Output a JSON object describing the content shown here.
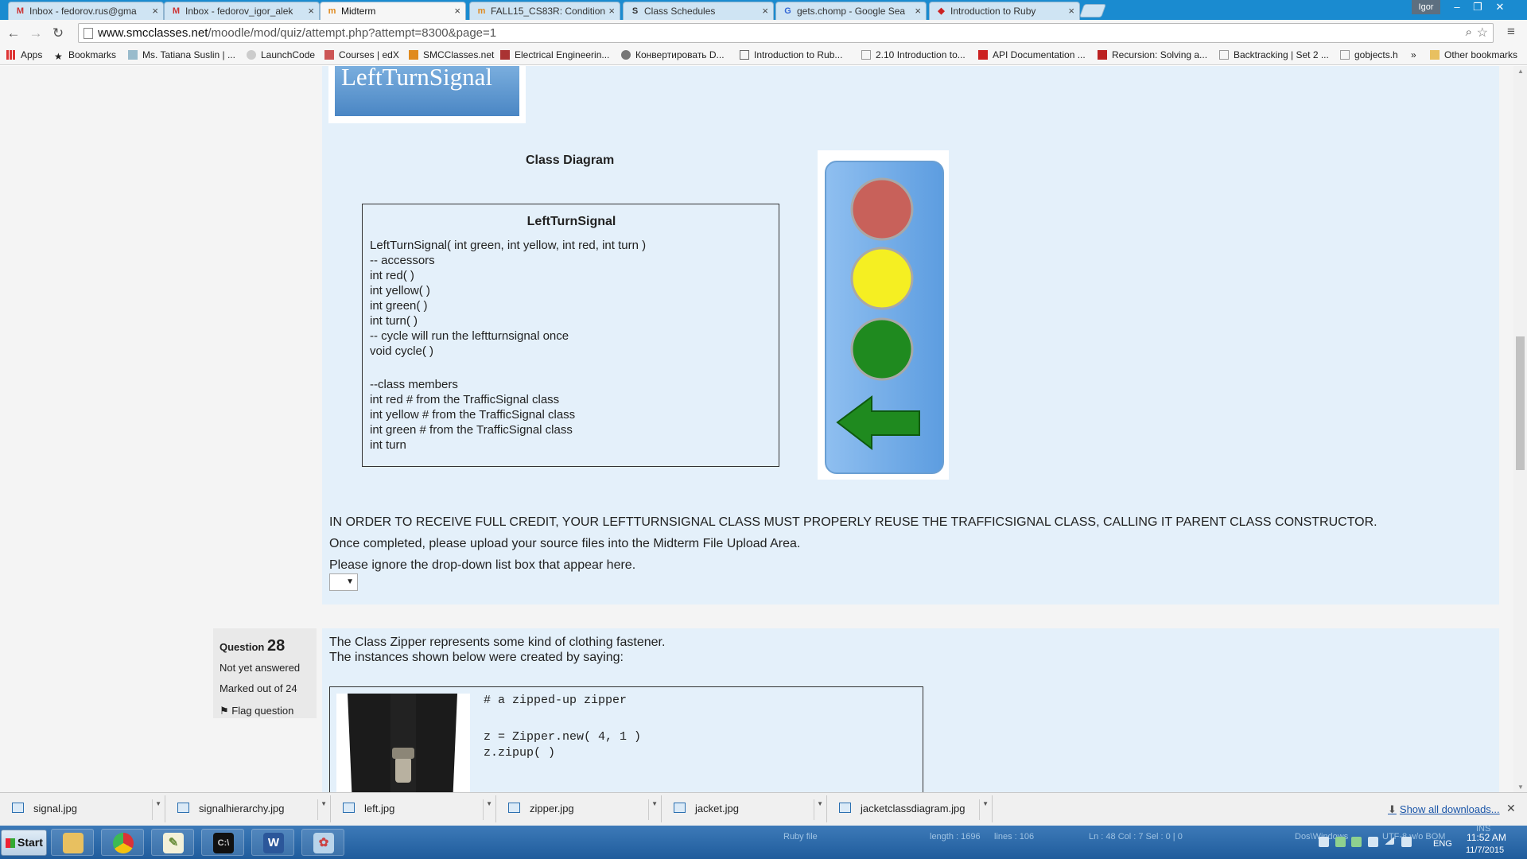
{
  "tabs": [
    {
      "title": "Inbox - fedorov.rus@gma",
      "icon": "gmail-icon"
    },
    {
      "title": "Inbox - fedorov_igor_alek",
      "icon": "gmail-icon"
    },
    {
      "title": "Midterm",
      "icon": "moodle-icon",
      "active": true
    },
    {
      "title": "FALL15_CS83R: Condition",
      "icon": "moodle-icon"
    },
    {
      "title": "Class Schedules",
      "icon": "smc-icon"
    },
    {
      "title": "gets.chomp - Google Sea",
      "icon": "google-icon"
    },
    {
      "title": "Introduction to Ruby",
      "icon": "ruby-icon"
    }
  ],
  "window": {
    "profile_name": "Igor",
    "minimize": "–",
    "restore": "❐",
    "close": "✕"
  },
  "address_bar": {
    "host": "www.smcclasses.net",
    "path": "/moodle/mod/quiz/attempt.php?attempt=8300&page=1"
  },
  "bookmarks": [
    {
      "label": "Apps",
      "icon": "apps-grid-icon"
    },
    {
      "label": "Bookmarks",
      "icon": "star-icon"
    },
    {
      "label": "Ms. Tatiana Suslin | ...",
      "icon": "site-icon"
    },
    {
      "label": "LaunchCode",
      "icon": "rocket-icon"
    },
    {
      "label": "Courses | edX",
      "icon": "edx-icon"
    },
    {
      "label": "SMCClasses.net",
      "icon": "moodle-icon"
    },
    {
      "label": "Electrical Engineerin...",
      "icon": "site-icon"
    },
    {
      "label": "Конвертировать D...",
      "icon": "site-icon"
    },
    {
      "label": "Introduction to Rub...",
      "icon": "page-icon"
    },
    {
      "label": "2.10 Introduction to...",
      "icon": "page-icon"
    },
    {
      "label": "API Documentation ...",
      "icon": "site-icon"
    },
    {
      "label": "Recursion: Solving a...",
      "icon": "site-icon"
    },
    {
      "label": "Backtracking | Set 2 ...",
      "icon": "page-icon"
    },
    {
      "label": "gobjects.h",
      "icon": "page-icon"
    },
    {
      "label": "»",
      "icon": ""
    },
    {
      "label": "Other bookmarks",
      "icon": "folder-icon"
    }
  ],
  "question27": {
    "logo_text": "LeftTurnSignal",
    "diagram_title": "Class Diagram",
    "class_name": "LeftTurnSignal",
    "members": [
      "LeftTurnSignal( int green, int yellow, int red, int turn )",
      "-- accessors",
      "int red( )",
      "int yellow( )",
      "int green( )",
      "int turn( )",
      "-- cycle will run the leftturnsignal once",
      "void cycle( )",
      "",
      "--class members",
      "int red # from the TrafficSignal class",
      "int yellow # from the TrafficSignal class",
      "int green # from the TrafficSignal class",
      "int turn"
    ],
    "instruction": "IN ORDER TO RECEIVE FULL CREDIT, YOUR LEFTTURNSIGNAL CLASS MUST PROPERLY REUSE THE TRAFFICSIGNAL CLASS, CALLING IT PARENT CLASS CONSTRUCTOR.",
    "upload_note": "Once completed, please upload your source files into the Midterm File Upload Area.",
    "ignore_note": "Please ignore the drop-down list box that appear here.",
    "dropdown_value": ""
  },
  "question28": {
    "label": "Question",
    "number": "28",
    "status": "Not yet answered",
    "mark": "Marked out of 24",
    "flag": "Flag question",
    "desc_line1": "The Class Zipper represents some kind of clothing fastener.",
    "desc_line2": "The instances shown below were created by saying:",
    "code": [
      "# a zipped-up zipper",
      "",
      "z = Zipper.new( 4, 1 )",
      "z.zipup( )"
    ]
  },
  "downloads": [
    "signal.jpg",
    "signalhierarchy.jpg",
    "left.jpg",
    "zipper.jpg",
    "jacket.jpg",
    "jacketclassdiagram.jpg"
  ],
  "downloads_show_all": "Show all downloads...",
  "taskbar": {
    "start": "Start",
    "editor_status": {
      "type": "Ruby file",
      "length": "length : 1696",
      "lines": "lines : 106",
      "position": "Ln : 48    Col : 7    Sel : 0 | 0",
      "eol": "Dos\\Windows",
      "encoding": "UTF-8 w/o BOM",
      "mode": "INS"
    },
    "language": "ENG",
    "time": "11:52 AM",
    "date": "11/7/2015"
  },
  "colors": {
    "panel": "#e4f0fa",
    "titlebar": "#1a8bd0",
    "signal_red": "#c8615a",
    "signal_yellow": "#f5ef22",
    "signal_green": "#1f8a1f"
  }
}
